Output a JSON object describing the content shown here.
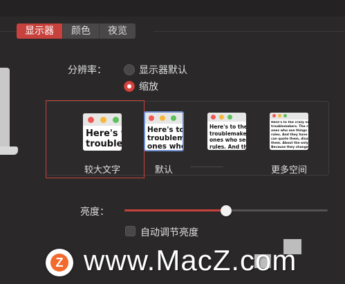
{
  "tabs": [
    {
      "label": "显示器",
      "active": true
    },
    {
      "label": "颜色",
      "active": false
    },
    {
      "label": "夜览",
      "active": false
    }
  ],
  "resolution": {
    "label": "分辨率：",
    "options": [
      {
        "label": "显示器默认",
        "selected": false
      },
      {
        "label": "缩放",
        "selected": true
      }
    ]
  },
  "scaled_options": [
    {
      "label": "较大文字",
      "preview_text": "Here's to\ntroublem",
      "selected": true
    },
    {
      "label": "默认",
      "preview_text": "Here's to\ntroublemak\nones who",
      "selected": false
    },
    {
      "label": "",
      "preview_text": "Here's to the\ntroublemakers\nones who see\nrules. And they",
      "selected": false
    },
    {
      "label": "更多空间",
      "preview_text": "Here's to the crazy one\ntroublemakers. The ro\nones who see things d\nrules. And they have n\ncan quote them, disagr\nthem. About the only t\nBecause they change",
      "selected": false
    }
  ],
  "brightness": {
    "label": "亮度：",
    "value": 0.5
  },
  "auto_brightness": {
    "label": "自动调节亮度",
    "checked": false
  },
  "watermark": {
    "logo_letter": "Z",
    "text": "www.MacZ.com"
  },
  "colors": {
    "accent": "#c7423d",
    "red": "#ee5a52",
    "yellow": "#f5b83a",
    "green": "#5cc15a"
  }
}
